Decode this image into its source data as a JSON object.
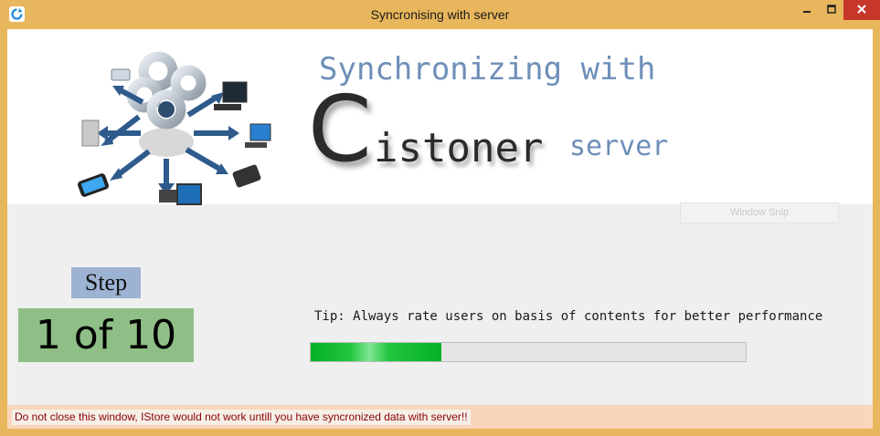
{
  "window": {
    "title": "Syncronising with server",
    "icons": {
      "app": "sync-app-icon",
      "minimize": "minimize-icon",
      "maximize": "maximize-icon",
      "close": "close-icon"
    }
  },
  "header": {
    "heading": "Synchronizing with",
    "brand_initial": "C",
    "brand_rest": "istoner",
    "server_word": "server",
    "logo": "network-sync-logo"
  },
  "overlay": {
    "snip_label": "Window Snip"
  },
  "step": {
    "label": "Step",
    "counter": "1 of 10"
  },
  "tip": {
    "text": "Tip: Always rate users on basis of contents for better performance"
  },
  "progress": {
    "fraction": 0.3
  },
  "warning": {
    "text": "Do not close this window, IStore would not work untill you have syncronized data with server!!"
  },
  "colors": {
    "titlebar": "#e8b65c",
    "close_button": "#c7362b",
    "heading_blue": "#6e8fb8",
    "step_label_bg": "#9db3d3",
    "step_counter_bg": "#8fbf86",
    "progress_green": "#06b025",
    "warning_bg": "#f9d6bb",
    "warning_text": "#8b0000"
  }
}
